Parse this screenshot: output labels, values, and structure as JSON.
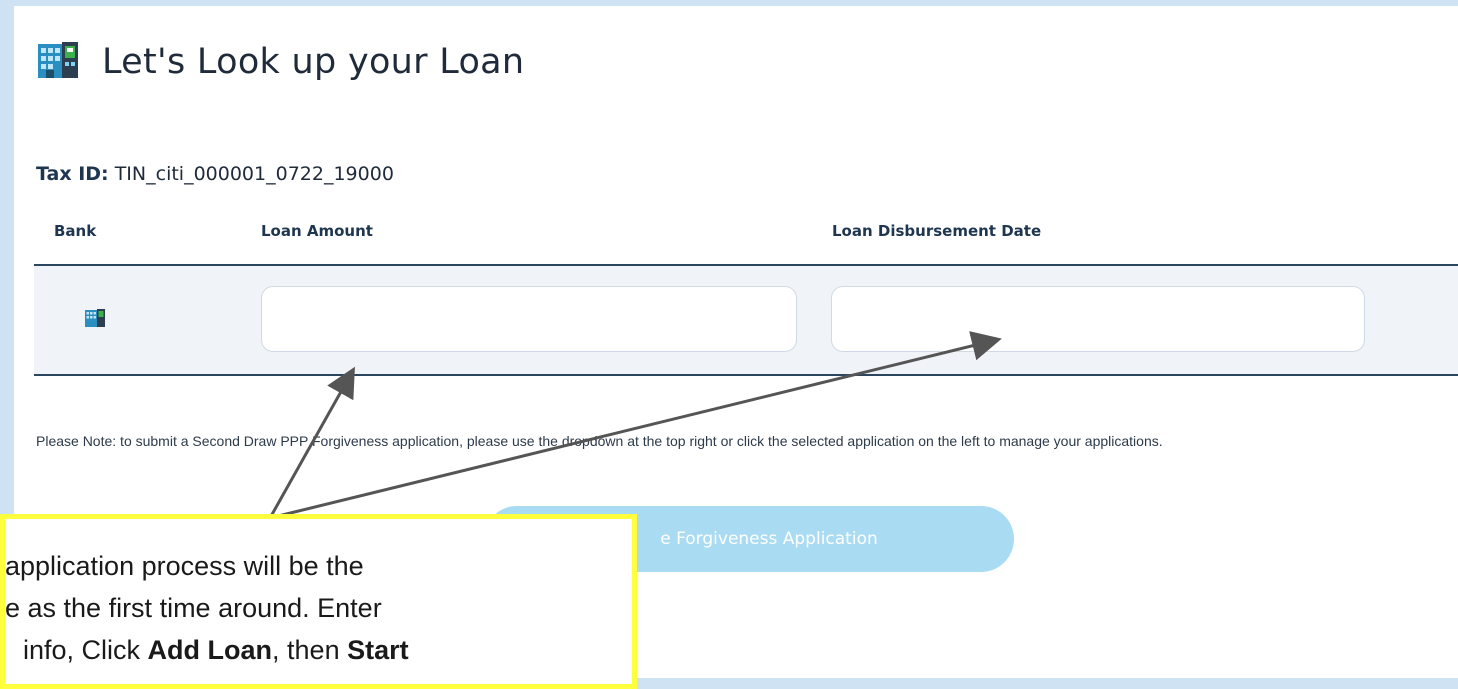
{
  "header": {
    "title": "Let's Look up your Loan",
    "icon": "building-icon"
  },
  "tax_id": {
    "label": "Tax ID:",
    "value": "TIN_citi_000001_0722_19000"
  },
  "table": {
    "columns": {
      "bank": "Bank",
      "amount": "Loan Amount",
      "date": "Loan Disbursement Date"
    },
    "row": {
      "bank_icon": "building-icon",
      "amount_value": "",
      "date_value": ""
    }
  },
  "note": "Please Note: to submit a Second Draw PPP Forgiveness application, please use the dropdown at the top right or click the selected application on the left to manage your applications.",
  "start_button": {
    "label": "e Forgiveness Application",
    "color": "#a9dcf2"
  },
  "callout": {
    "line1": "application process will be the",
    "line2": "e as the first time around. Enter",
    "line3_pre": "info, Click ",
    "line3_b1": "Add Loan",
    "line3_mid": ", then ",
    "line3_b2": "Start",
    "border_color": "#ffff3d"
  },
  "colors": {
    "background": "#cfe2f3",
    "heading": "#1f3650",
    "row": "#f0f4f8"
  }
}
